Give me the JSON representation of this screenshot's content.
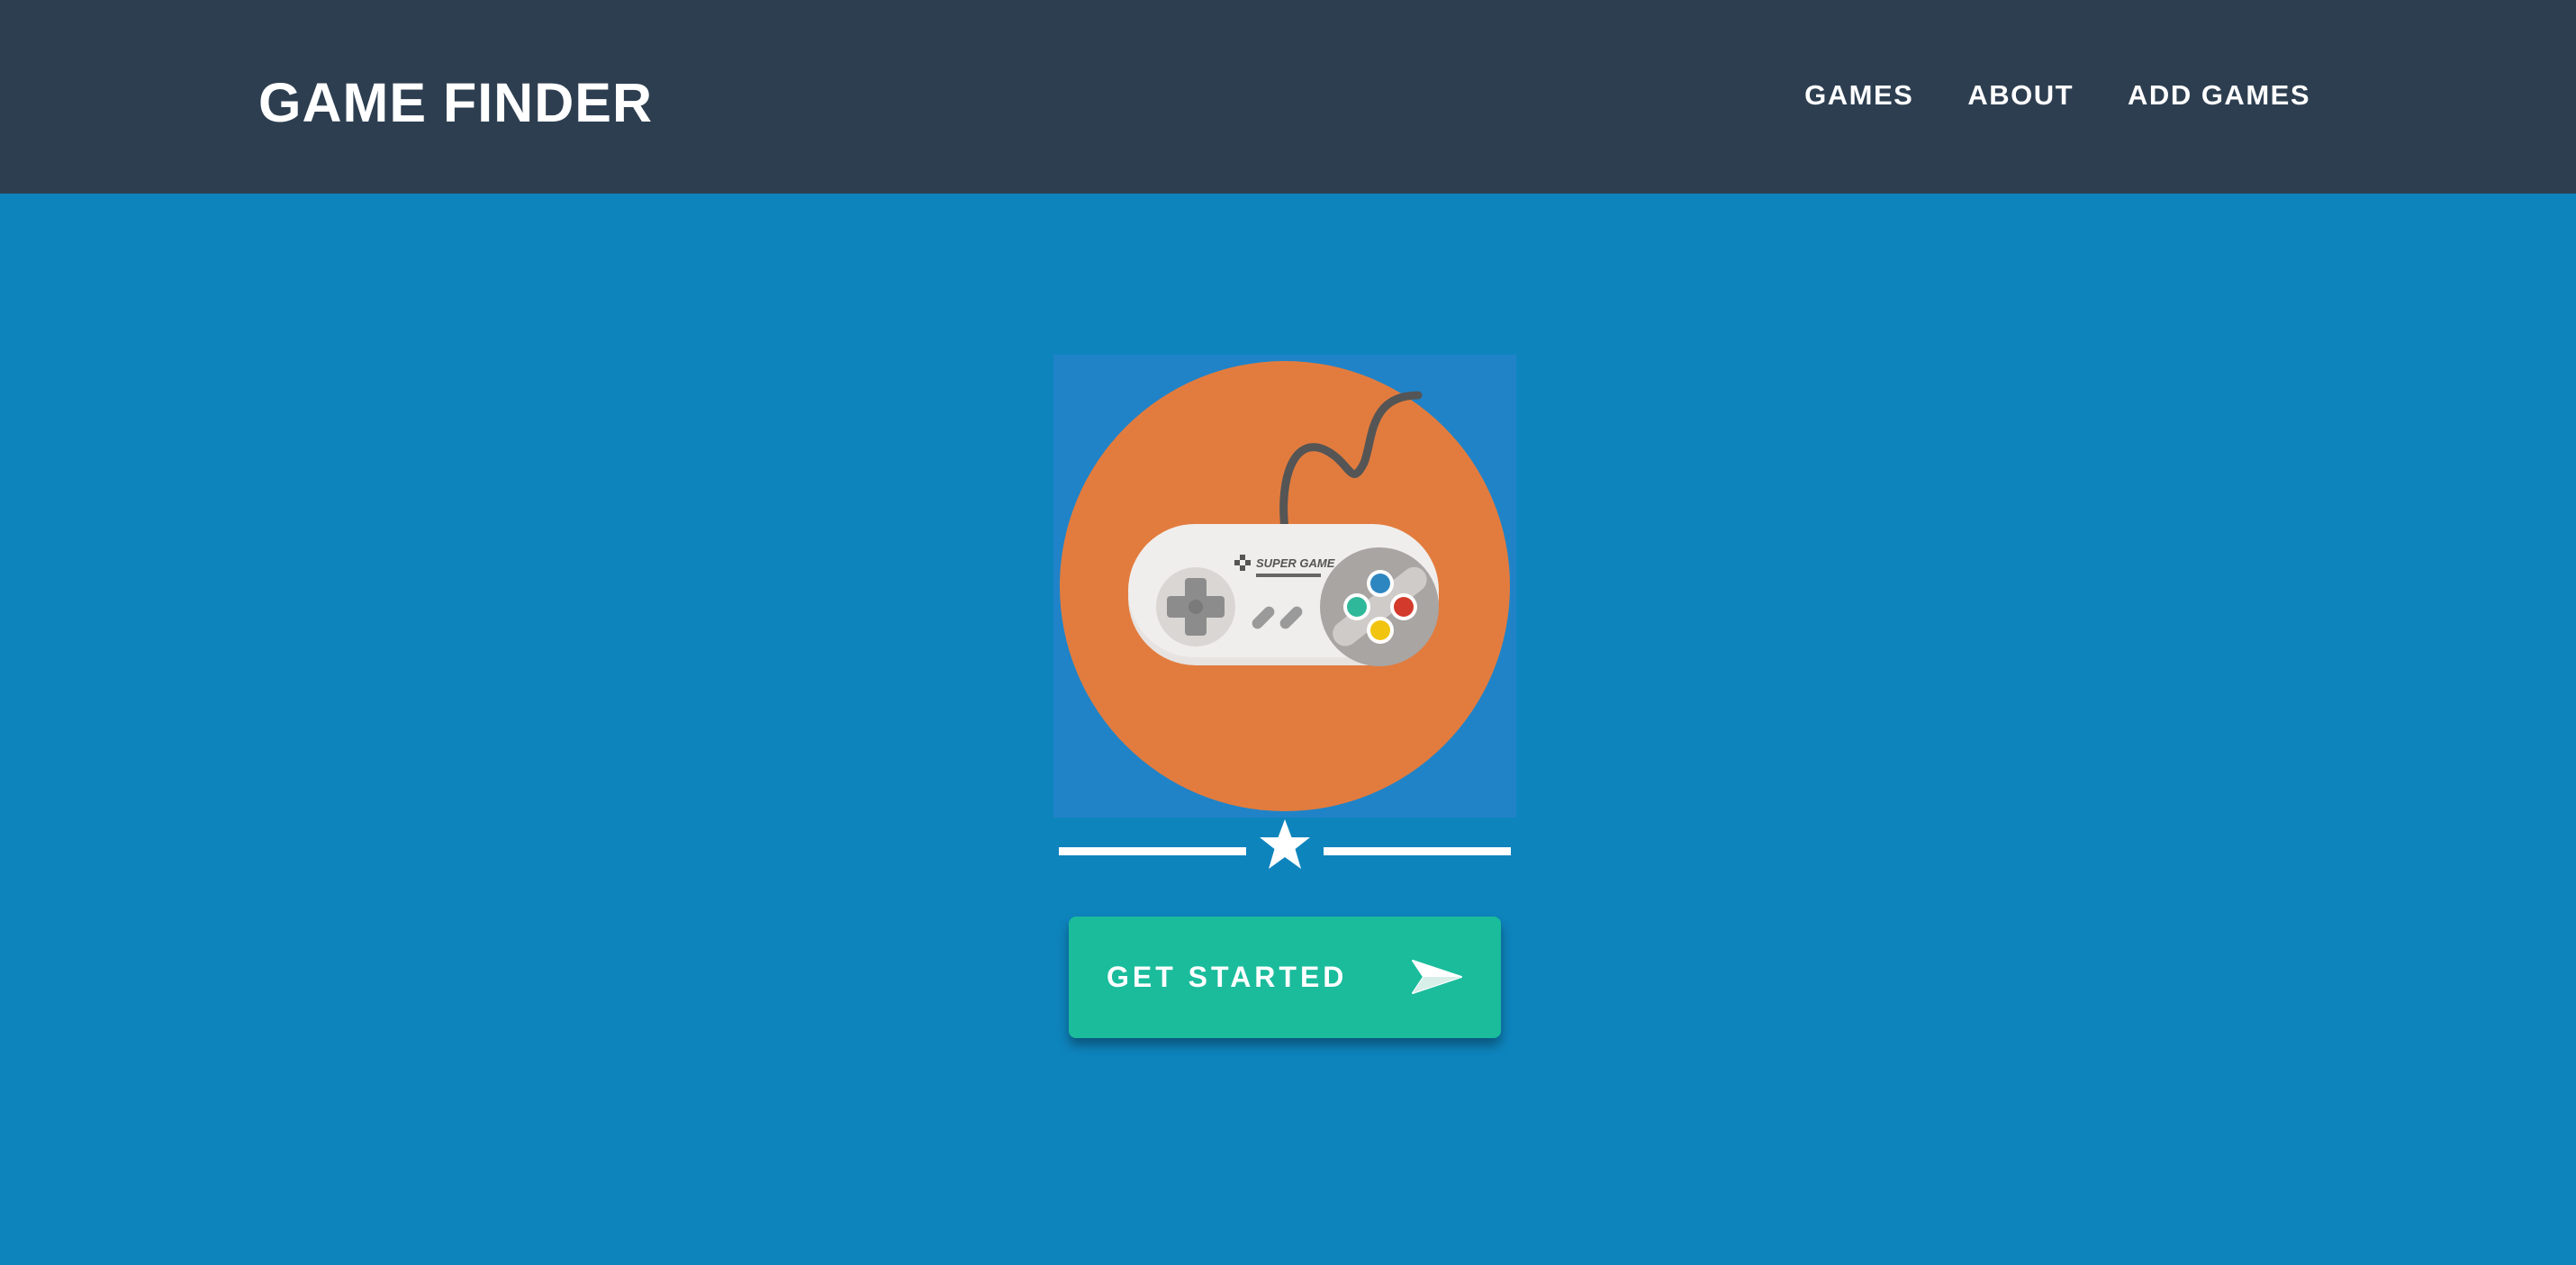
{
  "navbar": {
    "brand": "GAME FINDER",
    "links": [
      {
        "label": "GAMES"
      },
      {
        "label": "ABOUT"
      },
      {
        "label": "ADD GAMES"
      }
    ]
  },
  "hero": {
    "image": {
      "icon": "game-controller-icon",
      "controller_text": "SUPER GAME"
    },
    "divider_icon": "star-icon",
    "cta": {
      "label": "GET STARTED",
      "icon": "paper-plane-icon"
    }
  },
  "colors": {
    "navbar_bg": "#2d3e50",
    "page_bg": "#0e84bd",
    "image_circle": "#e27c3e",
    "cta_bg": "#1abc9c",
    "text": "#ffffff"
  }
}
